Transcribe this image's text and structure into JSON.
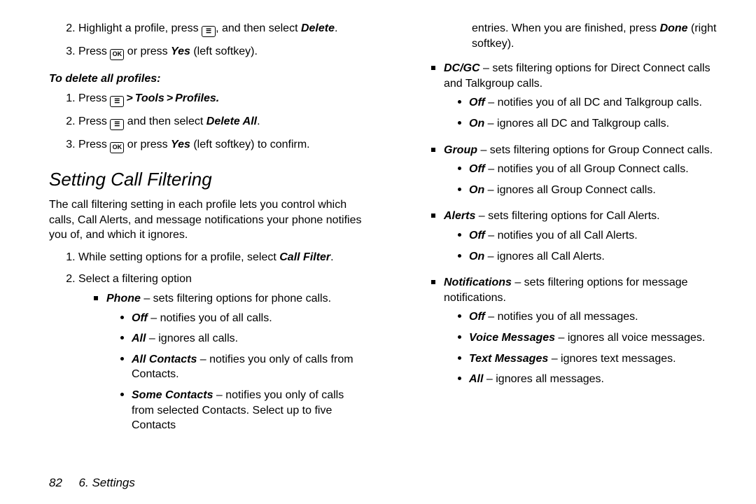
{
  "left": {
    "step2_a": "Highlight a profile, press ",
    "step2_b": ", and then select ",
    "step2_delete": "Delete",
    "step2_dot": ".",
    "step3_a": "Press ",
    "step3_ok": "OK",
    "step3_b": " or press ",
    "step3_yes": "Yes",
    "step3_c": " (left softkey).",
    "delall_head": "To delete all profiles:",
    "da1_a": "Press ",
    "da1_tools": "Tools",
    "da1_profiles": "Profiles",
    "da1_dot": ".",
    "da2_a": "Press ",
    "da2_b": " and then select ",
    "da2_delall": "Delete All",
    "da2_dot": ".",
    "da3_a": "Press ",
    "da3_ok": "OK",
    "da3_b": " or press ",
    "da3_yes": "Yes",
    "da3_c": " (left softkey) to confirm.",
    "section": "Setting Call Filtering",
    "intro": "The call filtering setting in each profile lets you control which calls, Call Alerts, and message notifications your phone notifies you of, and which it ignores.",
    "cf1_a": "While setting options for a profile, select ",
    "cf1_label": "Call Filter",
    "cf1_dot": ".",
    "cf2": "Select a filtering option",
    "phone_lbl": "Phone",
    "phone_txt": " – sets filtering options for phone calls.",
    "p_off_l": "Off",
    "p_off_t": " – notifies you of all calls.",
    "p_all_l": "All",
    "p_all_t": " – ignores all calls.",
    "p_ac_l": "All Contacts",
    "p_ac_t": " – notifies you only of calls from Contacts.",
    "p_sc_l": "Some Contacts",
    "p_sc_t": " – notifies you only of calls from selected Contacts. Select up to five Contacts"
  },
  "right": {
    "cont_a": "entries. When you are finished, press ",
    "cont_done": "Done",
    "cont_b": " (right softkey).",
    "dcgc_l": "DC/GC",
    "dcgc_t": " – sets filtering options for Direct Connect calls and Talkgroup calls.",
    "dcgc_off_l": "Off",
    "dcgc_off_t": " – notifies you of all DC and Talkgroup calls.",
    "dcgc_on_l": "On",
    "dcgc_on_t": " – ignores all DC and Talkgroup calls.",
    "grp_l": "Group",
    "grp_t": " – sets filtering options for Group Connect calls.",
    "grp_off_l": "Off",
    "grp_off_t": " – notifies you of all Group Connect calls.",
    "grp_on_l": "On",
    "grp_on_t": " – ignores all Group Connect calls.",
    "al_l": "Alerts",
    "al_t": " – sets filtering options for Call Alerts.",
    "al_off_l": "Off",
    "al_off_t": " – notifies you of all Call Alerts.",
    "al_on_l": "On",
    "al_on_t": " – ignores all Call Alerts.",
    "nt_l": "Notifications",
    "nt_t": " – sets filtering options for message notifications.",
    "nt_off_l": "Off",
    "nt_off_t": " – notifies you of all messages.",
    "nt_vm_l": "Voice Messages",
    "nt_vm_t": " – ignores all voice messages.",
    "nt_tm_l": "Text Messages",
    "nt_tm_t": " – ignores text messages.",
    "nt_all_l": "All",
    "nt_all_t": " – ignores all messages."
  },
  "footer": {
    "page": "82",
    "chap": "6. Settings"
  },
  "icons": {
    "menu_key": "☰",
    "ok_key": "OK"
  }
}
